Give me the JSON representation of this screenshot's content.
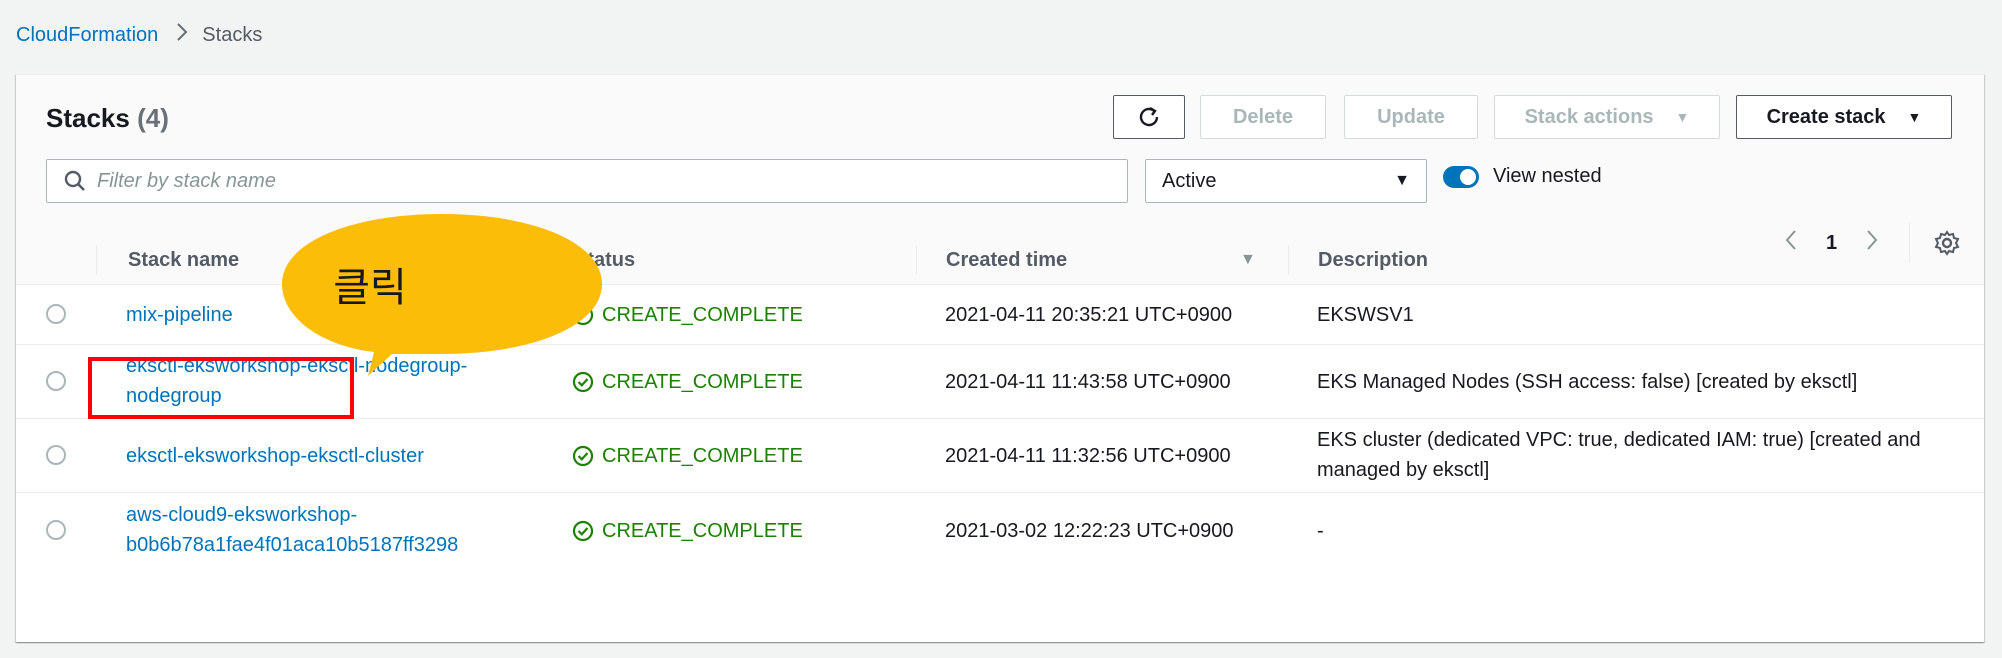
{
  "breadcrumb": {
    "root": "CloudFormation",
    "current": "Stacks"
  },
  "header": {
    "title": "Stacks",
    "count": "(4)"
  },
  "toolbar": {
    "refresh_icon": "refresh-icon",
    "delete_label": "Delete",
    "update_label": "Update",
    "stack_actions_label": "Stack actions",
    "create_stack_label": "Create stack"
  },
  "filter": {
    "placeholder": "Filter by stack name",
    "value": ""
  },
  "status_select": {
    "selected": "Active"
  },
  "toggle": {
    "label": "View nested",
    "on": true
  },
  "pagination": {
    "page": "1"
  },
  "columns": {
    "name": "Stack name",
    "status": "Status",
    "created": "Created time",
    "description": "Description"
  },
  "stacks": [
    {
      "name_line1": "mix-pipeline",
      "name_line2": "",
      "status": "CREATE_COMPLETE",
      "created": "2021-04-11 20:35:21 UTC+0900",
      "desc_line1": "EKSWSV1",
      "desc_line2": ""
    },
    {
      "name_line1": "eksctl-eksworkshop-eksctl-nodegroup-",
      "name_line2": "nodegroup",
      "status": "CREATE_COMPLETE",
      "created": "2021-04-11 11:43:58 UTC+0900",
      "desc_line1": "EKS Managed Nodes (SSH access: false) [created by eksctl]",
      "desc_line2": ""
    },
    {
      "name_line1": "eksctl-eksworkshop-eksctl-cluster",
      "name_line2": "",
      "status": "CREATE_COMPLETE",
      "created": "2021-04-11 11:32:56 UTC+0900",
      "desc_line1": "EKS cluster (dedicated VPC: true, dedicated IAM: true) [created and",
      "desc_line2": "managed by eksctl]"
    },
    {
      "name_line1": "aws-cloud9-eksworkshop-",
      "name_line2": "b0b6b78a1fae4f01aca10b5187ff3298",
      "status": "CREATE_COMPLETE",
      "created": "2021-03-02 12:22:23 UTC+0900",
      "desc_line1": "-",
      "desc_line2": ""
    }
  ],
  "annotation": {
    "callout_text": "클릭",
    "callout_color": "#fbbd08",
    "highlight_color": "#ff0000"
  },
  "colors": {
    "link": "#0073bb",
    "success": "#1d8102",
    "toggle": "#0073bb"
  }
}
